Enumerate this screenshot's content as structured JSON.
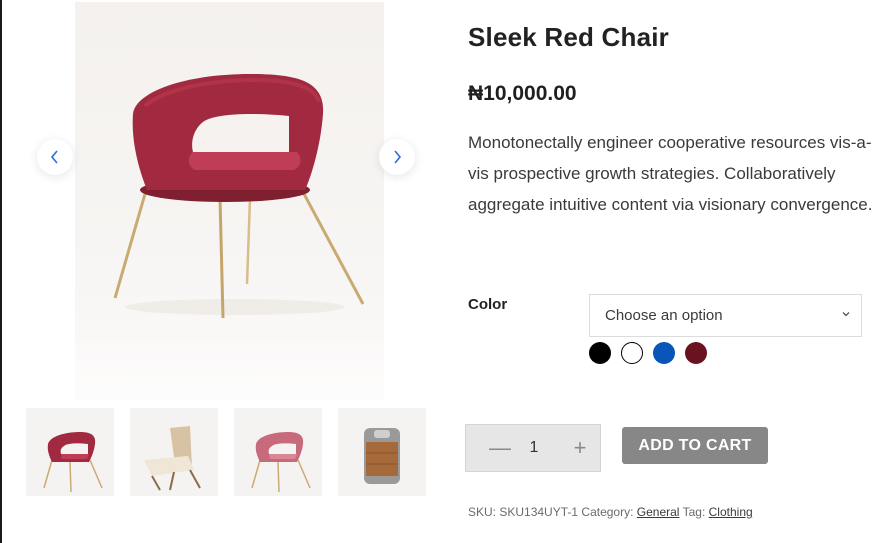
{
  "product": {
    "title": "Sleek Red Chair",
    "price": "₦10,000.00",
    "description": "Monotonectally engineer cooperative resources vis-a-vis prospective growth strategies. Collaboratively aggregate intuitive content via visionary convergence."
  },
  "gallery": {
    "prev_icon": "chevron-left-icon",
    "next_icon": "chevron-right-icon",
    "thumbnails": [
      {
        "name": "thumb-red-chair"
      },
      {
        "name": "thumb-lounge-chair"
      },
      {
        "name": "thumb-pink-chair"
      },
      {
        "name": "thumb-wood-stool"
      }
    ]
  },
  "variation": {
    "label": "Color",
    "select_value": "Choose an option",
    "swatches": [
      {
        "name": "black",
        "color": "#000000"
      },
      {
        "name": "white",
        "color": "#ffffff"
      },
      {
        "name": "blue",
        "color": "#0a55b8"
      },
      {
        "name": "maroon",
        "color": "#6b1220"
      }
    ]
  },
  "cart": {
    "minus": "—",
    "quantity": "1",
    "plus": "+",
    "button_label": "ADD TO CART"
  },
  "meta": {
    "sku_label": "SKU:",
    "sku": "SKU134UYT-1",
    "category_label": "Category:",
    "category": "General",
    "tag_label": "Tag:",
    "tag": "Clothing"
  }
}
